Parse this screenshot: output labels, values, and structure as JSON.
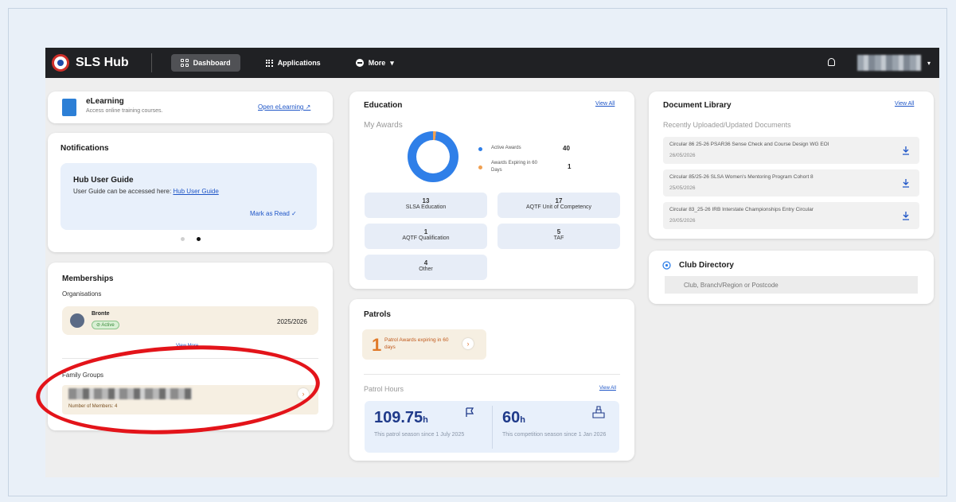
{
  "topbar": {
    "brand": "SLS Hub",
    "nav": [
      {
        "label": "Dashboard",
        "active": true
      },
      {
        "label": "Applications",
        "active": false
      },
      {
        "label": "More",
        "active": false
      }
    ],
    "more_caret": "▾",
    "user_caret": "▾"
  },
  "elearning": {
    "title": "eLearning",
    "subtitle": "Access online training courses.",
    "link": "Open eLearning ↗"
  },
  "notifications": {
    "title": "Notifications",
    "item_title": "Hub User Guide",
    "item_text": "User Guide can be accessed here: ",
    "item_link": "Hub User Guide",
    "mark_read": "Mark as Read ✓"
  },
  "memberships": {
    "title": "Memberships",
    "organisations_label": "Organisations",
    "org_name": "Bronte",
    "org_status": "Active",
    "org_season": "2025/2026",
    "view_more": "View More",
    "family_label": "Family Groups",
    "family_members": "Number of Members: 4"
  },
  "education": {
    "title": "Education",
    "view_all": "View All",
    "awards_label": "My Awards",
    "legend": [
      {
        "label": "Active Awards",
        "value": "40",
        "color": "#2f7fe8"
      },
      {
        "label": "Awards Expiring in 60 Days",
        "value": "1",
        "color": "#f0a052"
      }
    ],
    "tiles": [
      {
        "value": "13",
        "label": "SLSA Education"
      },
      {
        "value": "17",
        "label": "AQTF Unit of Competency"
      },
      {
        "value": "1",
        "label": "AQTF Qualification"
      },
      {
        "value": "5",
        "label": "TAF"
      },
      {
        "value": "4",
        "label": "Other"
      }
    ]
  },
  "patrols": {
    "title": "Patrols",
    "alert_count": "1",
    "alert_text": "Patrol Awards expiring in 60 days",
    "hours_label": "Patrol Hours",
    "view_all": "View All",
    "patrol_hours": "109.75",
    "patrol_unit": "h",
    "patrol_desc": "This patrol season since 1 July 2025",
    "comp_hours": "60",
    "comp_unit": "h",
    "comp_desc": "This competition season since 1 Jan 2026"
  },
  "documents": {
    "title": "Document Library",
    "view_all": "View All",
    "subtitle": "Recently Uploaded/Updated Documents",
    "rows": [
      {
        "title": "Circular 86 25-26 PSAR36 Sense Check and Course Design WG EOI",
        "date": "26/05/2026"
      },
      {
        "title": "Circular 85/25-26 SLSA Women's Mentoring Program Cohort 8",
        "date": "25/05/2026"
      },
      {
        "title": "Circular 83_25-26 IRB Interstate Championships Entry Circular",
        "date": "20/05/2026"
      }
    ]
  },
  "club_directory": {
    "title": "Club Directory",
    "placeholder": "Club, Branch/Region or Postcode"
  }
}
